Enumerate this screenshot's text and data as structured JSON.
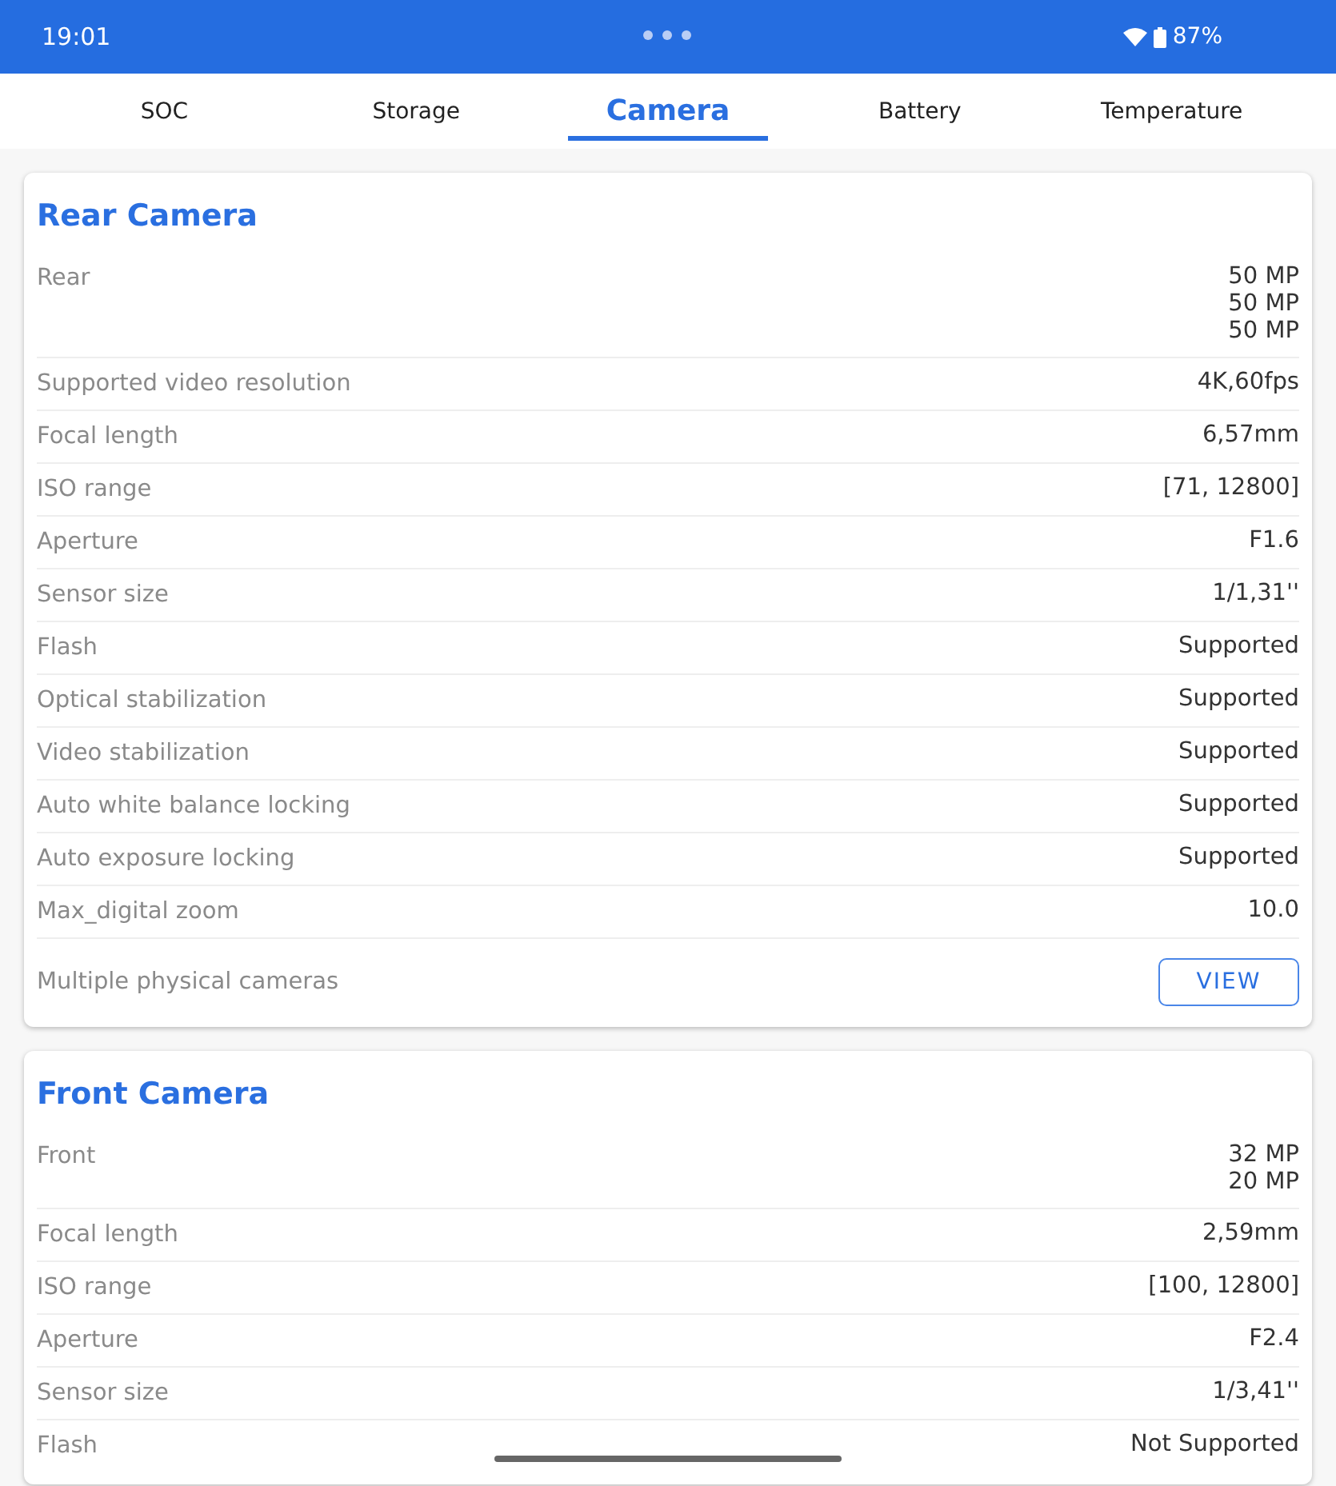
{
  "status_bar": {
    "time": "19:01",
    "battery": "87%"
  },
  "tabs": [
    {
      "label": "SOC",
      "selected": false
    },
    {
      "label": "Storage",
      "selected": false
    },
    {
      "label": "Camera",
      "selected": true
    },
    {
      "label": "Battery",
      "selected": false
    },
    {
      "label": "Temperature",
      "selected": false
    }
  ],
  "cards": [
    {
      "title": "Rear Camera",
      "rows": [
        {
          "kind": "text",
          "label": "Rear",
          "values": [
            "50 MP",
            "50 MP",
            "50 MP"
          ]
        },
        {
          "kind": "text",
          "label": "Supported video resolution",
          "values": [
            "4K,60fps"
          ]
        },
        {
          "kind": "text",
          "label": "Focal length",
          "values": [
            "6,57mm"
          ]
        },
        {
          "kind": "text",
          "label": "ISO range",
          "values": [
            "[71, 12800]"
          ]
        },
        {
          "kind": "text",
          "label": "Aperture",
          "values": [
            "F1.6"
          ]
        },
        {
          "kind": "text",
          "label": "Sensor size",
          "values": [
            "1/1,31''"
          ]
        },
        {
          "kind": "text",
          "label": "Flash",
          "values": [
            "Supported"
          ]
        },
        {
          "kind": "text",
          "label": "Optical stabilization",
          "values": [
            "Supported"
          ]
        },
        {
          "kind": "text",
          "label": "Video stabilization",
          "values": [
            "Supported"
          ]
        },
        {
          "kind": "text",
          "label": "Auto white balance locking",
          "values": [
            "Supported"
          ]
        },
        {
          "kind": "text",
          "label": "Auto exposure locking",
          "values": [
            "Supported"
          ]
        },
        {
          "kind": "text",
          "label": "Max_digital zoom",
          "values": [
            "10.0"
          ]
        },
        {
          "kind": "button",
          "label": "Multiple physical cameras",
          "button": "VIEW"
        }
      ]
    },
    {
      "title": "Front Camera",
      "rows": [
        {
          "kind": "text",
          "label": "Front",
          "values": [
            "32 MP",
            "20 MP"
          ]
        },
        {
          "kind": "text",
          "label": "Focal length",
          "values": [
            "2,59mm"
          ]
        },
        {
          "kind": "text",
          "label": "ISO range",
          "values": [
            "[100, 12800]"
          ]
        },
        {
          "kind": "text",
          "label": "Aperture",
          "values": [
            "F2.4"
          ]
        },
        {
          "kind": "text",
          "label": "Sensor size",
          "values": [
            "1/3,41''"
          ]
        },
        {
          "kind": "text",
          "label": "Flash",
          "values": [
            "Not Supported"
          ]
        }
      ]
    }
  ]
}
